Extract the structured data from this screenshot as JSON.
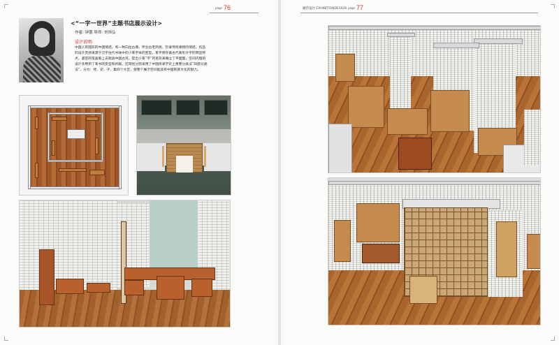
{
  "left_page": {
    "page_label": "page",
    "page_number": "76",
    "title": "<“一字一世界”主题书店展示设计>",
    "author_line": "作者: 钟蕾    导师: 刘恒弘",
    "description_heading": "设计说明:",
    "description": "中国人有图形的中国情结，有一种向往古典，怀念古老风情，珍爱传统事物的情结。作品的设计灵感来源于汉字古代书体中的小篆字体的变型，篆字保存着古代象形文字的明显特点，紧密的笔画看上去颇具中国古风。提出小篆“字”的意形来确立了平面图，空间内墙的设计多用到了篆书的变型和拆解。区域划分则采用了中国目录学史上重要分类法“四部分类法”，分为：经、史、子、集四个大区，使整个展示空间能具有中国民族文化的魅力。"
  },
  "right_page": {
    "running_head": "展示设计 EXHIBITIONDESIGN",
    "page_label": "page",
    "page_number": "77"
  },
  "colors": {
    "accent": "#cc3333",
    "wood": "#b5713a",
    "wall": "#eeeeea"
  }
}
